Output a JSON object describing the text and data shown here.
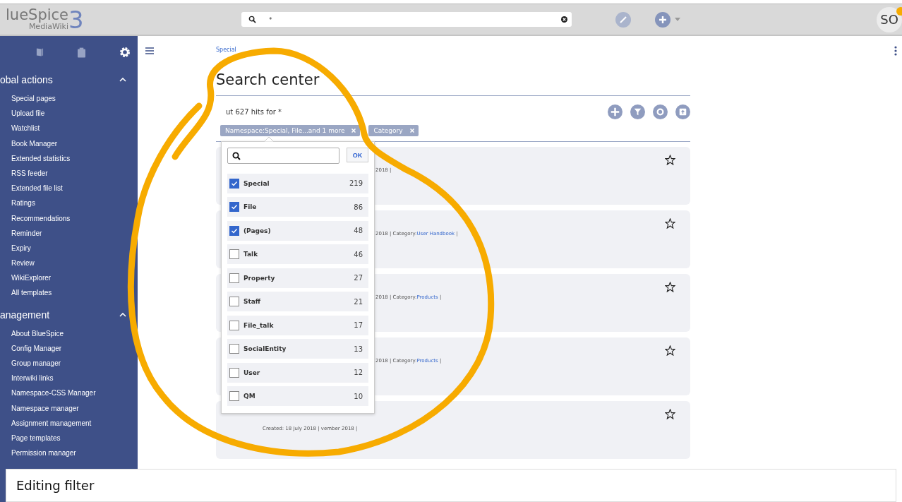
{
  "header": {
    "logo_main": "lueSpice",
    "logo_sub": "MediaWiki",
    "logo_number": "3",
    "search_value": "*",
    "avatar_initials": "SO"
  },
  "sidebar": {
    "sections": [
      {
        "title": "obal actions",
        "expanded": true,
        "items": [
          "Special pages",
          "Upload file",
          "Watchlist",
          "Book Manager",
          "Extended statistics",
          "RSS feeder",
          "Extended file list",
          "Ratings",
          "Recommendations",
          "Reminder",
          "Expiry",
          "Review",
          "WikiExplorer",
          "All templates"
        ]
      },
      {
        "title": "anagement",
        "expanded": true,
        "items": [
          "About BlueSpice",
          "Config Manager",
          "Group manager",
          "Interwiki links",
          "Namespace-CSS Manager",
          "Namespace manager",
          "Assignment management",
          "Page templates",
          "Permission manager"
        ]
      }
    ]
  },
  "breadcrumb": "Special",
  "page_title": "Search center",
  "hits_text": "ut 627 hits for *",
  "filters": [
    {
      "label": "Namespace:Special, File...and 1 more"
    },
    {
      "label": "Category"
    }
  ],
  "filter_popup": {
    "ok_label": "OK",
    "options": [
      {
        "label": "Special",
        "count": "219",
        "checked": true
      },
      {
        "label": "File",
        "count": "86",
        "checked": true
      },
      {
        "label": "(Pages)",
        "count": "48",
        "checked": true
      },
      {
        "label": "Talk",
        "count": "46",
        "checked": false
      },
      {
        "label": "Property",
        "count": "27",
        "checked": false
      },
      {
        "label": "Staff",
        "count": "21",
        "checked": false
      },
      {
        "label": "File_talk",
        "count": "17",
        "checked": false
      },
      {
        "label": "SocialEntity",
        "count": "13",
        "checked": false
      },
      {
        "label": "User",
        "count": "12",
        "checked": false
      },
      {
        "label": "QM",
        "count": "10",
        "checked": false
      }
    ]
  },
  "results": [
    {
      "meta": "2018 |",
      "kind": "partial"
    },
    {
      "meta": "2018 | Category:",
      "category": "User Handbook",
      "end": "|",
      "kind": "partial"
    },
    {
      "meta": "2018 | Category:",
      "category": "Products",
      "end": "|",
      "kind": "partial"
    },
    {
      "meta": "2018 | Category:",
      "category": "Products",
      "end": "|",
      "kind": "partial"
    },
    {
      "meta": "Created: 18 July 2018 | vember 2018 |",
      "kind": "wide"
    }
  ],
  "caption": "Editing filter"
}
